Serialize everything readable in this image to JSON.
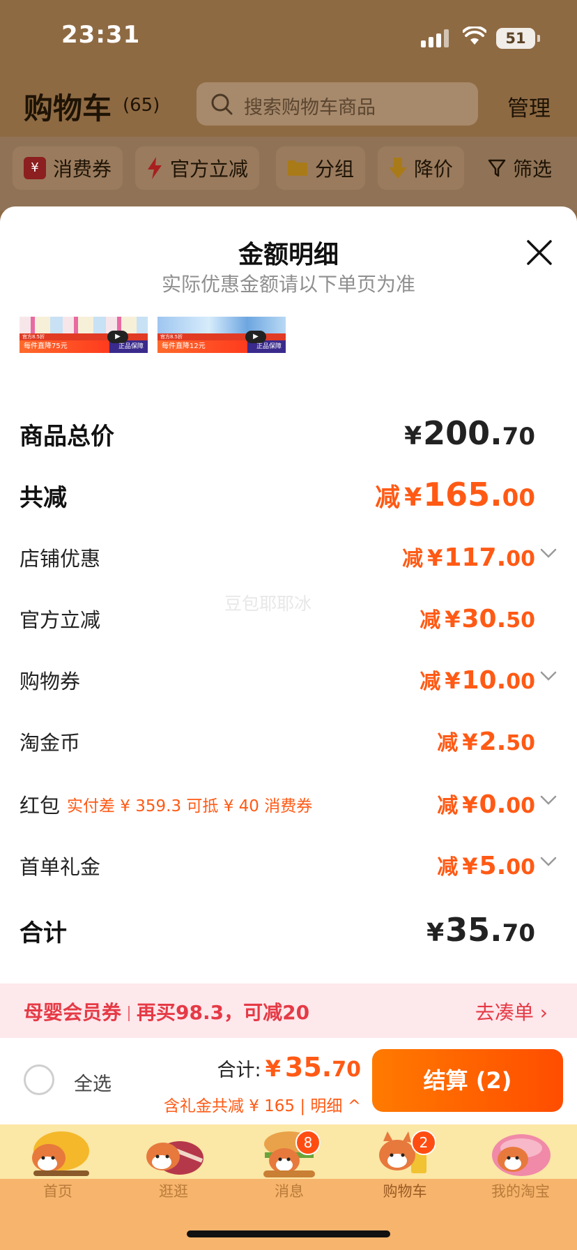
{
  "status_bar": {
    "time": "23:31",
    "battery": "51"
  },
  "header": {
    "title": "购物车",
    "count": "(65)",
    "search_placeholder": "搜索购物车商品",
    "manage": "管理"
  },
  "filters": [
    {
      "label": "消费券",
      "icon": "coupon-icon"
    },
    {
      "label": "官方立减",
      "icon": "lightning-icon"
    },
    {
      "label": "分组",
      "icon": "folder-icon"
    },
    {
      "label": "降价",
      "icon": "arrow-down-icon"
    },
    {
      "label": "筛选",
      "icon": "filter-icon"
    }
  ],
  "sheet": {
    "title": "金额明细",
    "subtitle": "实际优惠金额请以下单页为准",
    "thumbnails": [
      {
        "band": "官方8.5折",
        "strip": "每件直降75元",
        "guarantee": "正品保障"
      },
      {
        "band": "官方8.5折",
        "strip": "每件直降12元",
        "guarantee": "正品保障"
      }
    ],
    "rows": {
      "subtotal": {
        "label": "商品总价",
        "yen": "¥",
        "int": "200.",
        "dec": "70"
      },
      "total_discount": {
        "label": "共减",
        "prefix": "减",
        "yen": "¥",
        "int": "165.",
        "dec": "00"
      },
      "shop": {
        "label": "店铺优惠",
        "prefix": "减",
        "yen": "¥",
        "int": "117.",
        "dec": "00"
      },
      "official": {
        "label": "官方立减",
        "prefix": "减",
        "yen": "¥",
        "int": "30.",
        "dec": "50"
      },
      "voucher": {
        "label": "购物券",
        "prefix": "减",
        "yen": "¥",
        "int": "10.",
        "dec": "00"
      },
      "coin": {
        "label": "淘金币",
        "prefix": "减",
        "yen": "¥",
        "int": "2.",
        "dec": "50"
      },
      "hongbao": {
        "label": "红包",
        "note": "实付差 ¥ 359.3 可抵 ¥ 40 消费券",
        "prefix": "减",
        "yen": "¥",
        "int": "0.",
        "dec": "00"
      },
      "first_order": {
        "label": "首单礼金",
        "prefix": "减",
        "yen": "¥",
        "int": "5.",
        "dec": "00"
      },
      "total": {
        "label": "合计",
        "yen": "¥",
        "int": "35.",
        "dec": "70"
      }
    },
    "watermark": "豆包耶耶冰"
  },
  "promo": {
    "title": "母婴会员券",
    "text": "再买98.3，可减20",
    "action": "去凑单 ›"
  },
  "checkout": {
    "select_all": "全选",
    "total_label": "合计:",
    "total_yen": "¥",
    "total_int": "35.",
    "total_dec": "70",
    "discount_note": "含礼金共减 ¥ 165 | 明细 ^",
    "button": "结算 (2)"
  },
  "tabs": [
    {
      "label": "首页",
      "badge": ""
    },
    {
      "label": "逛逛",
      "badge": ""
    },
    {
      "label": "消息",
      "badge": "8"
    },
    {
      "label": "购物车",
      "badge": "2"
    },
    {
      "label": "我的淘宝",
      "badge": ""
    }
  ],
  "colors": {
    "accent": "#ff5a15",
    "checkout_button": "#ff6a00",
    "promo_text": "#e53a46",
    "promo_bg": "#fde8ec"
  }
}
